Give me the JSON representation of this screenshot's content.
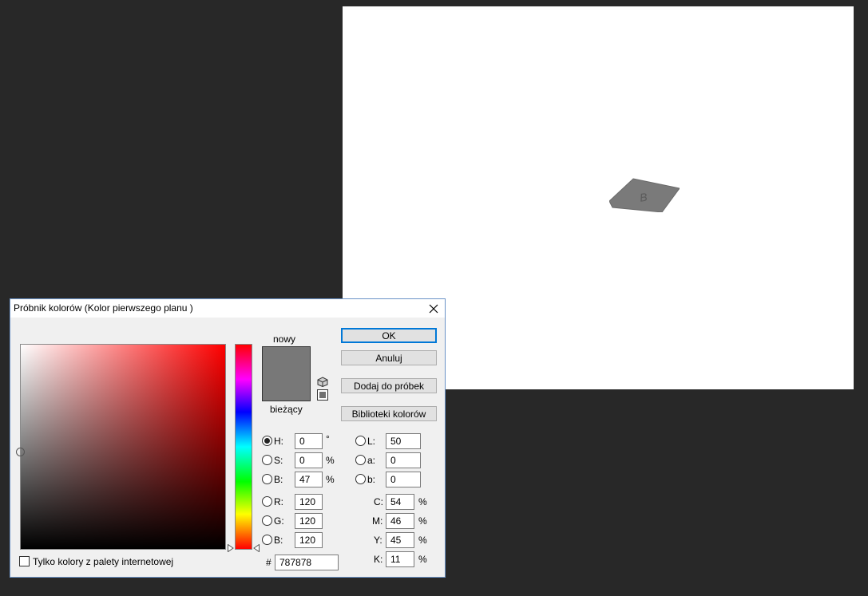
{
  "canvas": {
    "card_letter": "B"
  },
  "dialog": {
    "title": "Próbnik kolorów (Kolor pierwszego planu )",
    "new_label": "nowy",
    "current_label": "bieżący",
    "new_color": "#787878",
    "current_color": "#787878",
    "buttons": {
      "ok": "OK",
      "cancel": "Anuluj",
      "add_swatch": "Dodaj do próbek",
      "libraries": "Biblioteki kolorów"
    },
    "hsb": {
      "h_label": "H:",
      "h_value": "0",
      "h_unit": "°",
      "s_label": "S:",
      "s_value": "0",
      "s_unit": "%",
      "b_label": "B:",
      "b_value": "47",
      "b_unit": "%"
    },
    "rgb": {
      "r_label": "R:",
      "r_value": "120",
      "g_label": "G:",
      "g_value": "120",
      "b_label": "B:",
      "b_value": "120"
    },
    "lab": {
      "l_label": "L:",
      "l_value": "50",
      "a_label": "a:",
      "a_value": "0",
      "b_label": "b:",
      "b_value": "0"
    },
    "cmyk": {
      "c_label": "C:",
      "c_value": "54",
      "c_unit": "%",
      "m_label": "M:",
      "m_value": "46",
      "m_unit": "%",
      "y_label": "Y:",
      "y_value": "45",
      "y_unit": "%",
      "k_label": "K:",
      "k_value": "11",
      "k_unit": "%"
    },
    "hex_label": "#",
    "hex_value": "787878",
    "web_only_label": "Tylko kolory z palety internetowej"
  }
}
